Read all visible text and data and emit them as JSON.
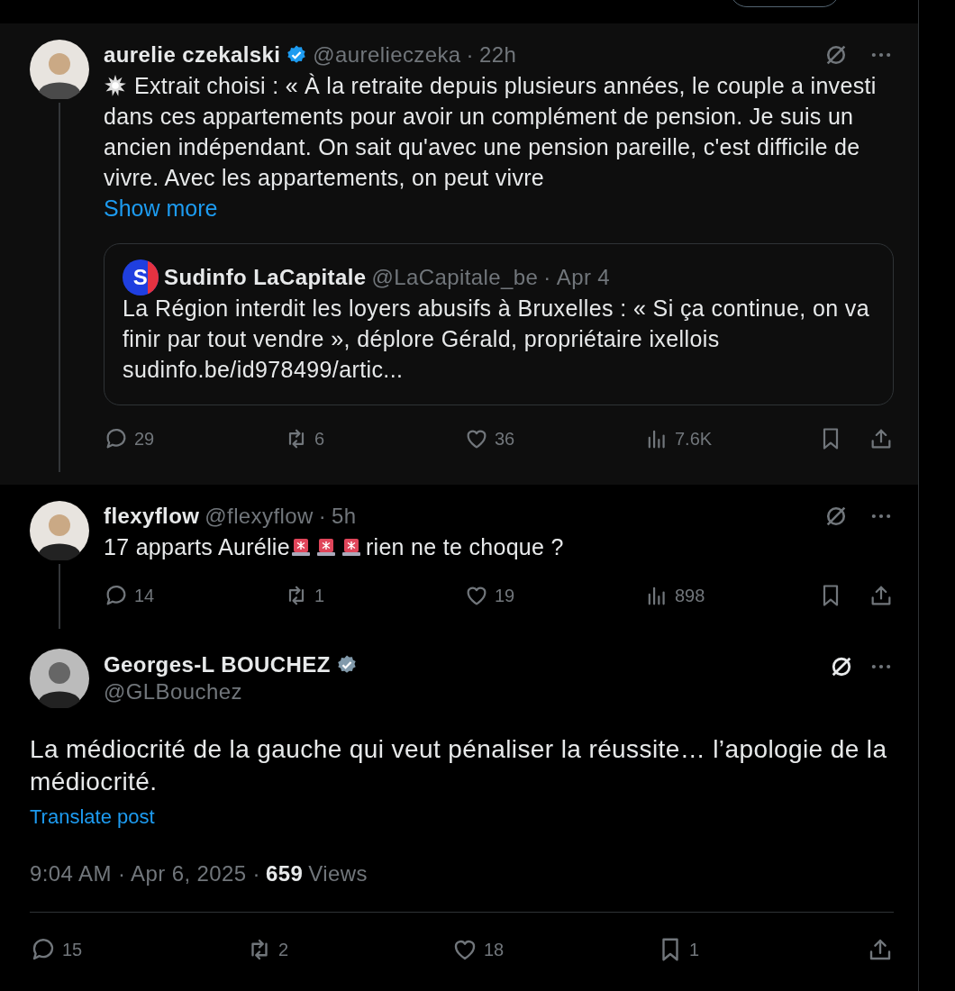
{
  "replies": [
    {
      "name": "aurelie czekalski",
      "badge": {
        "color": "#1d9bf0"
      },
      "handle": "@aurelieczeka",
      "sep": "·",
      "time": "22h",
      "highlighted": true,
      "body": [
        {
          "kind": "burst"
        },
        {
          "kind": "text",
          "text": "Extrait choisi : « À la retraite depuis plusieurs années, le couple a investi dans ces appartements pour avoir un complément de pension. Je suis un ancien indépendant. On sait qu'avec une pension pareille, c'est difficile de vivre. Avec les appartements, on peut vivre"
        }
      ],
      "show_more": "Show more",
      "quote": {
        "logo_text": "S",
        "name": "Sudinfo LaCapitale",
        "handle": "@LaCapitale_be",
        "sep": "·",
        "time": "Apr 4",
        "text": "La Région interdit les loyers abusifs à Bruxelles : « Si ça continue, on va finir par tout vendre », déplore Gérald, propriétaire ixellois",
        "link": "sudinfo.be/id978499/artic..."
      },
      "actions": [
        {
          "kind": "reply",
          "count": "29"
        },
        {
          "kind": "repost",
          "count": "6"
        },
        {
          "kind": "like",
          "count": "36"
        },
        {
          "kind": "views",
          "count": "7.6K"
        },
        {
          "kind": "bookmark"
        },
        {
          "kind": "share"
        }
      ]
    },
    {
      "name": "flexyflow",
      "handle": "@flexyflow",
      "sep": "·",
      "time": "5h",
      "highlighted": false,
      "body": [
        {
          "kind": "text",
          "text": "17 apparts Aurélie"
        },
        {
          "kind": "siren"
        },
        {
          "kind": "siren"
        },
        {
          "kind": "siren"
        },
        {
          "kind": "text",
          "text": "rien ne te choque ?"
        }
      ],
      "actions": [
        {
          "kind": "reply",
          "count": "14"
        },
        {
          "kind": "repost",
          "count": "1"
        },
        {
          "kind": "like",
          "count": "19"
        },
        {
          "kind": "views",
          "count": "898"
        },
        {
          "kind": "bookmark"
        },
        {
          "kind": "share"
        }
      ]
    }
  ],
  "main_post": {
    "name": "Georges-L BOUCHEZ",
    "badge": {
      "color": "#829aab"
    },
    "handle": "@GLBouchez",
    "text": "La médiocrité de la gauche qui veut pénaliser la réussite… l’apologie de la médiocrité.",
    "translate": "Translate post",
    "timestamp": "9:04 AM · Apr 6, 2025 · ",
    "views_count": "659",
    "views_label": "Views",
    "actions": [
      {
        "kind": "reply",
        "count": "15"
      },
      {
        "kind": "repost",
        "count": "2"
      },
      {
        "kind": "like",
        "count": "18"
      },
      {
        "kind": "bookmark",
        "count": "1"
      },
      {
        "kind": "share"
      }
    ]
  }
}
